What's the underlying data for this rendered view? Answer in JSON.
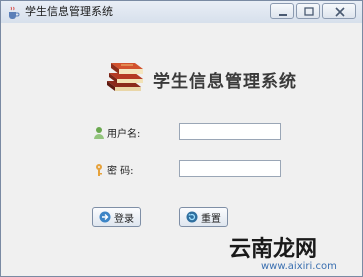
{
  "window": {
    "title": "学生信息管理系统",
    "app_icon": "java-cup-icon",
    "controls": [
      "minimize-icon",
      "maximize-icon",
      "close-icon"
    ]
  },
  "header": {
    "logo_icon": "books-stack-icon",
    "system_title": "学生信息管理系统"
  },
  "form": {
    "username": {
      "icon": "user-icon",
      "label": "用户名:",
      "value": ""
    },
    "password": {
      "icon": "key-icon",
      "label": "密 码:",
      "value": ""
    }
  },
  "buttons": {
    "login": {
      "icon": "login-icon",
      "label": "登录"
    },
    "reset": {
      "icon": "reset-icon",
      "label": "重置"
    }
  },
  "watermark": {
    "logo_text": "云南龙网",
    "url": "www.aixiri.com"
  }
}
